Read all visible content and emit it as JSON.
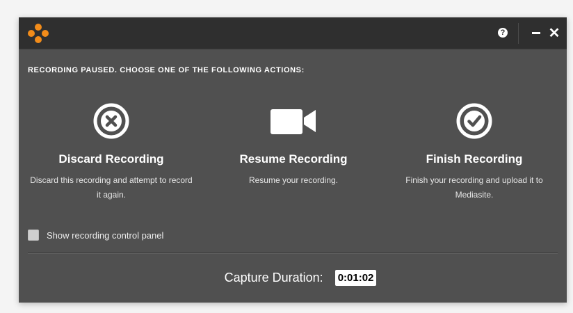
{
  "window": {
    "heading": "RECORDING PAUSED. CHOOSE ONE OF THE FOLLOWING ACTIONS:",
    "help_icon": "question-circle-icon",
    "help_glyph": "?",
    "close_glyph": "✕"
  },
  "actions": [
    {
      "title": "Discard Recording",
      "description": "Discard this recording and attempt to record it again.",
      "icon": "x-circle-icon"
    },
    {
      "title": "Resume Recording",
      "description": "Resume your recording.",
      "icon": "video-camera-icon"
    },
    {
      "title": "Finish Recording",
      "description": "Finish your recording and upload it to Mediasite.",
      "icon": "check-circle-icon"
    }
  ],
  "options": {
    "show_control_panel_label": "Show recording control panel",
    "show_control_panel_checked": false
  },
  "capture": {
    "label": "Capture Duration:",
    "value": "0:01:02"
  },
  "colors": {
    "accent": "#f28c1a",
    "titlebar": "#2f2f2f",
    "background": "#505050"
  }
}
